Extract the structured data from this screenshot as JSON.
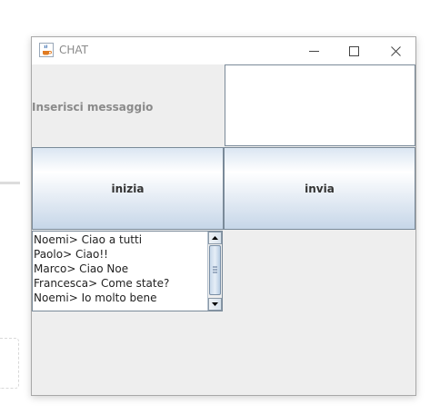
{
  "window": {
    "title": "CHAT"
  },
  "form": {
    "message_label": "Inserisci messaggio",
    "message_value": "",
    "start_button": "inizia",
    "send_button": "invia"
  },
  "chat": {
    "lines": [
      "Noemi> Ciao a tutti",
      "Paolo> Ciao!!",
      "Marco> Ciao Noe",
      "Francesca> Come state?",
      "Noemi> Io molto bene"
    ]
  },
  "icons": {
    "app": "java-coffee-icon",
    "minimize": "minimize-icon",
    "maximize": "maximize-icon",
    "close": "close-icon",
    "scroll_up": "arrow-up-icon",
    "scroll_down": "arrow-down-icon"
  },
  "colors": {
    "button_gradient_top": "#dbe6f2",
    "button_gradient_bottom": "#c6d6e8",
    "border": "#7a8a99",
    "panel": "#eeeeee"
  }
}
